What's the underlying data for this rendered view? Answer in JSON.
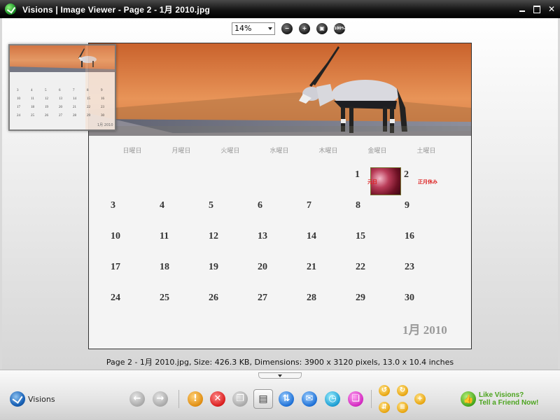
{
  "window": {
    "title": "Visions | Image Viewer - Page 2 - 1月 2010.jpg",
    "minimize_symbol": "",
    "close_symbol": "✕"
  },
  "toolbar": {
    "zoom_value": "14%",
    "icons": [
      "zoom-out-icon",
      "zoom-in-icon",
      "fit-to-window-icon",
      "actual-size-icon"
    ],
    "actual_size_label": "100%"
  },
  "calendar": {
    "weekdays": [
      "日曜日",
      "月曜日",
      "火曜日",
      "水曜日",
      "木曜日",
      "金曜日",
      "土曜日"
    ],
    "weeks": [
      [
        "",
        "",
        "",
        "",
        "",
        "1",
        "2"
      ],
      [
        "3",
        "4",
        "5",
        "6",
        "7",
        "8",
        "9"
      ],
      [
        "10",
        "11",
        "12",
        "13",
        "14",
        "15",
        "16"
      ],
      [
        "17",
        "18",
        "19",
        "20",
        "21",
        "22",
        "23"
      ],
      [
        "24",
        "25",
        "26",
        "27",
        "28",
        "29",
        "30"
      ]
    ],
    "holiday_1": "元日",
    "holiday_2": "正月休み",
    "month_label": "1月 2010"
  },
  "navigator": {
    "month_label": "1月 2010"
  },
  "status": {
    "text": "Page 2 - 1月 2010.jpg, Size: 426.3 KB, Dimensions: 3900 x 3120 pixels, 13.0 x 10.4 inches"
  },
  "bottom": {
    "brand": "Visions",
    "promo_line1": "Like Visions?",
    "promo_line2": "Tell a Friend Now!",
    "buttons": [
      "back-icon",
      "forward-icon",
      "info-icon",
      "delete-icon",
      "copy-icon",
      "print-icon",
      "share-icon",
      "email-icon",
      "history-icon",
      "slideshow-icon"
    ],
    "rotate_buttons": [
      "rotate-left-icon",
      "rotate-right-icon",
      "flip-icon",
      "more-icon",
      "add-icon"
    ]
  },
  "colors": {
    "accent_promo": "#4ca41f",
    "holiday_red": "#dd2222",
    "banner_orange": "#d8753c"
  }
}
